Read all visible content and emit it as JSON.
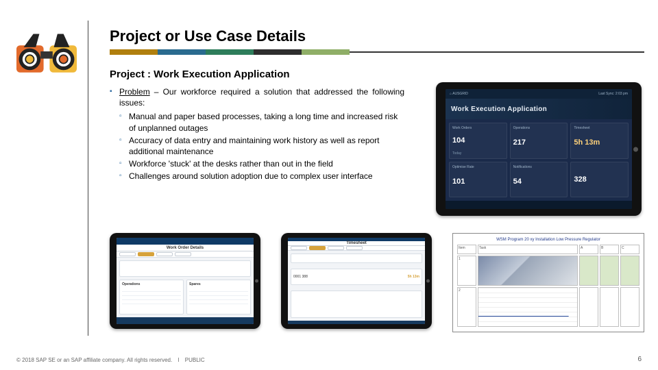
{
  "title": "Project or Use Case Details",
  "subtitle": "Project : Work Execution Application",
  "body": {
    "lead_label": "Problem",
    "lead_text": " –  Our workforce required a solution that addressed the following issues:",
    "bullets": [
      "Manual and paper based processes, taking a long time and increased risk of unplanned outages",
      "Accuracy of data entry and maintaining work history as well as report additional maintenance",
      "Workforce 'stuck' at the desks rather than out in the field",
      "Challenges around solution adoption due to complex user interface"
    ]
  },
  "big_app": {
    "topbar_left": "⌂  AUSGRID",
    "topbar_right": "Last Sync: 2:03 pm",
    "hero": "Work Execution Application",
    "tiles": [
      {
        "label": "Work Orders",
        "value": "104",
        "sub": "Today"
      },
      {
        "label": "Operations",
        "value": "217",
        "sub": ""
      },
      {
        "label": "Timesheet",
        "value": "5h 13m",
        "sub": "",
        "accent": true
      },
      {
        "label": "Optimise Rate",
        "value": "101",
        "sub": ""
      },
      {
        "label": "Notifications",
        "value": "54",
        "sub": ""
      },
      {
        "label": "",
        "value": "328",
        "sub": ""
      }
    ]
  },
  "small_app1": {
    "header": "Work Order Details",
    "left_hdr": "Operations",
    "right_hdr": "Spares"
  },
  "small_app2": {
    "header": "Timesheet",
    "card_line1": "0001 388",
    "card_line2": "5h 13m"
  },
  "doc": {
    "title": "WSM Program 20 xy Installation Low Pressure Regulator",
    "labels": [
      "Item",
      "Task",
      "A",
      "B",
      "C"
    ]
  },
  "footer": {
    "copyright": "© 2018 SAP SE or an SAP affiliate company. All rights reserved.",
    "classification": "PUBLIC",
    "page": "6"
  }
}
